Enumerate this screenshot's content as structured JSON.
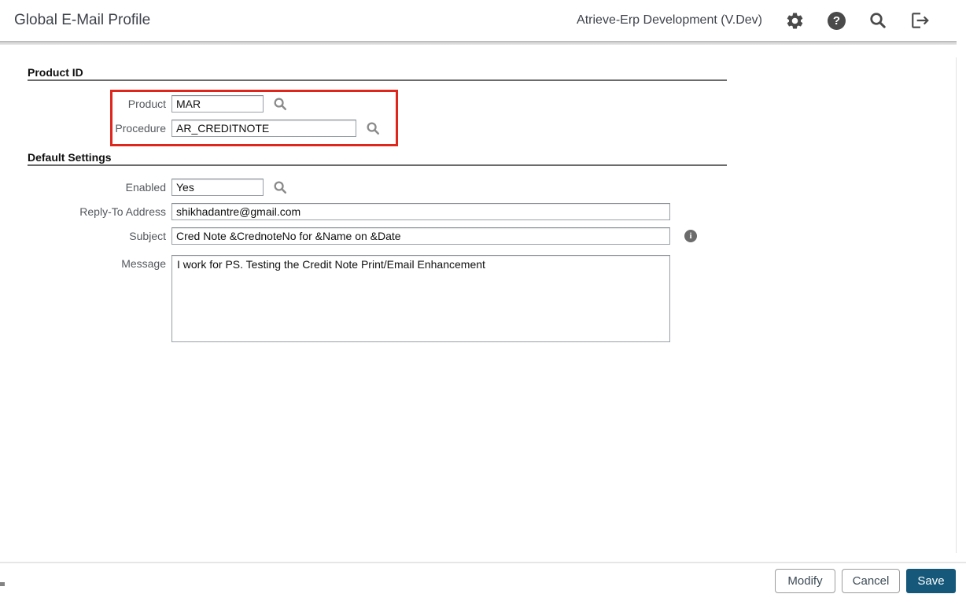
{
  "header": {
    "title": "Global E-Mail Profile",
    "environment": "Atrieve-Erp Development (V.Dev)",
    "icons": {
      "gear": "gear-icon",
      "help": "help-icon",
      "help_glyph": "?",
      "search": "search-icon",
      "logout": "logout-icon",
      "lookup": "magnifier-lookup-icon",
      "info": "info-icon",
      "info_glyph": "i"
    }
  },
  "sections": {
    "product_id": {
      "title": "Product ID"
    },
    "default_settings": {
      "title": "Default Settings"
    }
  },
  "form": {
    "product": {
      "label": "Product",
      "value": "MAR"
    },
    "procedure": {
      "label": "Procedure",
      "value": "AR_CREDITNOTE"
    },
    "enabled": {
      "label": "Enabled",
      "value": "Yes"
    },
    "reply_to": {
      "label": "Reply-To Address",
      "value": "shikhadantre@gmail.com"
    },
    "subject": {
      "label": "Subject",
      "value": "Cred Note &CrednoteNo for &Name on &Date"
    },
    "message": {
      "label": "Message",
      "value": "I work for PS. Testing the Credit Note Print/Email Enhancement"
    }
  },
  "footer": {
    "modify_label": "Modify",
    "cancel_label": "Cancel",
    "save_label": "Save"
  },
  "colors": {
    "accent_save": "#15587a",
    "annotation_red": "#df261c",
    "icon_gray": "#4a4a4a",
    "lookup_gray": "#8a8a8a"
  }
}
